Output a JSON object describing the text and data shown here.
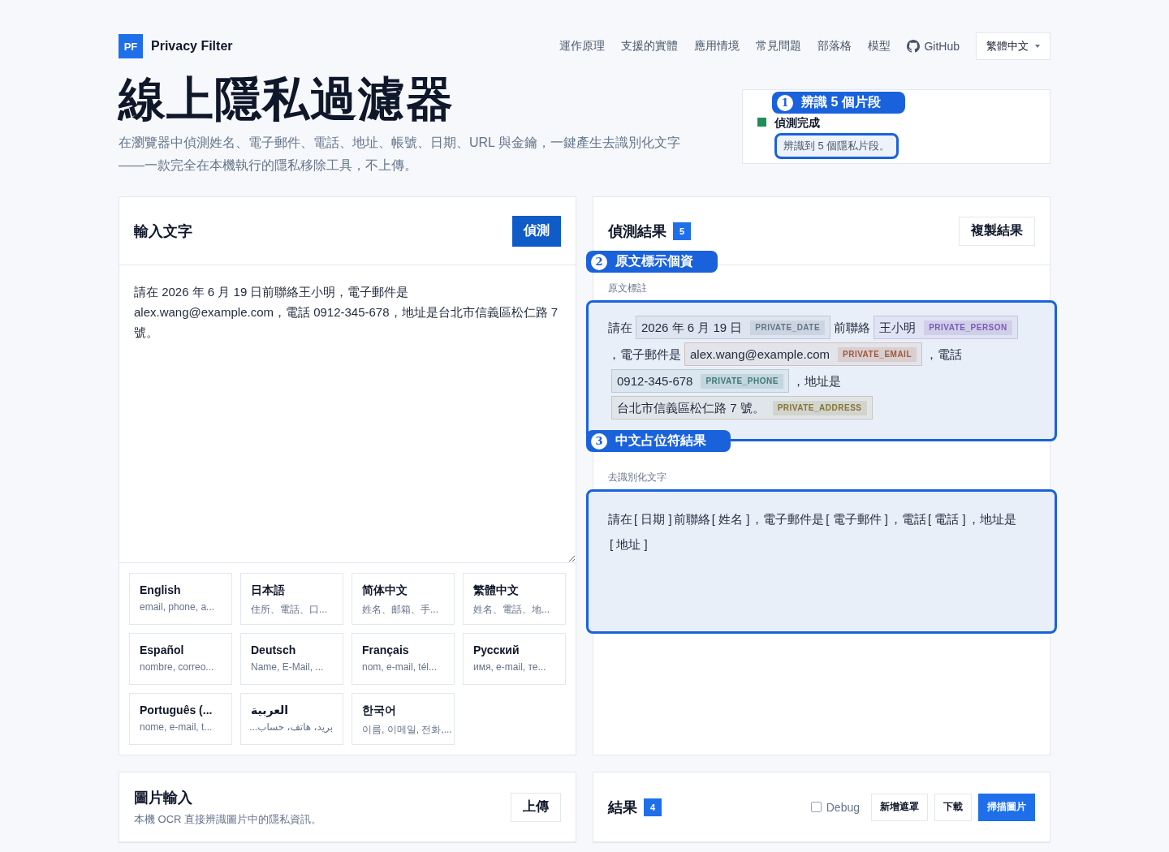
{
  "brand": {
    "logo": "PF",
    "name": "Privacy Filter"
  },
  "nav": [
    "運作原理",
    "支援的實體",
    "應用情境",
    "常見問題",
    "部落格",
    "模型"
  ],
  "github": "GitHub",
  "language_select": "繁體中文",
  "hero": {
    "title": "線上隱私過濾器",
    "subtitle": "在瀏覽器中偵測姓名、電子郵件、電話、地址、帳號、日期、URL 與金鑰，一鍵產生去識別化文字——一款完全在本機執行的隱私移除工具，不上傳。"
  },
  "status": {
    "title": "偵測完成",
    "message": "辨識到 5 個隱私片段。",
    "callout": {
      "number": "1",
      "text": "辨識 5 個片段"
    }
  },
  "input_panel": {
    "title": "輸入文字",
    "button": "偵測",
    "text": "請在 2026 年 6 月 19 日前聯絡王小明，電子郵件是 alex.wang@example.com，電話 0912-345-678，地址是台北市信義區松仁路 7 號。"
  },
  "languages": [
    {
      "name": "English",
      "sample": "email, phone, a..."
    },
    {
      "name": "日本語",
      "sample": "住所、電話、口..."
    },
    {
      "name": "简体中文",
      "sample": "姓名、邮箱、手..."
    },
    {
      "name": "繁體中文",
      "sample": "姓名、電話、地..."
    },
    {
      "name": "Español",
      "sample": "nombre, correo..."
    },
    {
      "name": "Deutsch",
      "sample": "Name, E-Mail, ..."
    },
    {
      "name": "Français",
      "sample": "nom, e-mail, tél..."
    },
    {
      "name": "Русский",
      "sample": "имя, e-mail, те..."
    },
    {
      "name": "Português (...",
      "sample": "nome, e-mail, t..."
    },
    {
      "name": "العربية",
      "sample": "بريد، هاتف، حساب...",
      "rtl": true
    },
    {
      "name": "한국어",
      "sample": "이름, 이메일, 전화,..."
    }
  ],
  "results_panel": {
    "title": "偵測結果",
    "count": "5",
    "copy_button": "複製結果",
    "annotated": {
      "label": "原文標註",
      "callout": {
        "number": "2",
        "text": "原文標示個資"
      },
      "segments": [
        {
          "kind": "text",
          "text": "請在"
        },
        {
          "kind": "entity",
          "text": "2026 年 6 月 19 日",
          "tag": "PRIVATE_DATE",
          "color": "#64748b"
        },
        {
          "kind": "text",
          "text": "前聯絡"
        },
        {
          "kind": "entity",
          "text": "王小明",
          "tag": "PRIVATE_PERSON",
          "color": "#7c5cb8"
        },
        {
          "kind": "text",
          "text": "，電子郵件是"
        },
        {
          "kind": "entity",
          "text": "alex.wang@example.com",
          "tag": "PRIVATE_EMAIL",
          "color": "#a0583a"
        },
        {
          "kind": "text",
          "text": "，電話"
        },
        {
          "kind": "entity",
          "text": "0912-345-678",
          "tag": "PRIVATE_PHONE",
          "color": "#3f7a7a"
        },
        {
          "kind": "text",
          "text": "，地址是"
        },
        {
          "kind": "entity",
          "text": "台北市信義區松仁路 7 號。",
          "tag": "PRIVATE_ADDRESS",
          "color": "#857436"
        }
      ]
    },
    "redacted": {
      "label": "去識別化文字",
      "callout": {
        "number": "3",
        "text": "中文占位符結果"
      },
      "segments": [
        {
          "kind": "text",
          "text": "請在"
        },
        {
          "kind": "placeholder",
          "text": "[ 日期 ]"
        },
        {
          "kind": "text",
          "text": "前聯絡"
        },
        {
          "kind": "placeholder",
          "text": "[ 姓名 ]"
        },
        {
          "kind": "text",
          "text": "，電子郵件是"
        },
        {
          "kind": "placeholder",
          "text": "[ 電子郵件 ]"
        },
        {
          "kind": "text",
          "text": "，電話"
        },
        {
          "kind": "placeholder",
          "text": "[ 電話 ]"
        },
        {
          "kind": "text",
          "text": "，地址是"
        },
        {
          "kind": "placeholder",
          "text": "[ 地址 ]"
        }
      ]
    }
  },
  "image_panel": {
    "title": "圖片輸入",
    "subtitle": "本機 OCR 直接辨識圖片中的隱私資訊。",
    "button": "上傳"
  },
  "image_results": {
    "title": "結果",
    "count": "4",
    "debug": {
      "label": "Debug",
      "checked": false
    },
    "buttons": [
      {
        "label": "新增遮罩",
        "kind": "outline"
      },
      {
        "label": "下載",
        "kind": "outline"
      },
      {
        "label": "掃描圖片",
        "kind": "primary"
      }
    ]
  }
}
